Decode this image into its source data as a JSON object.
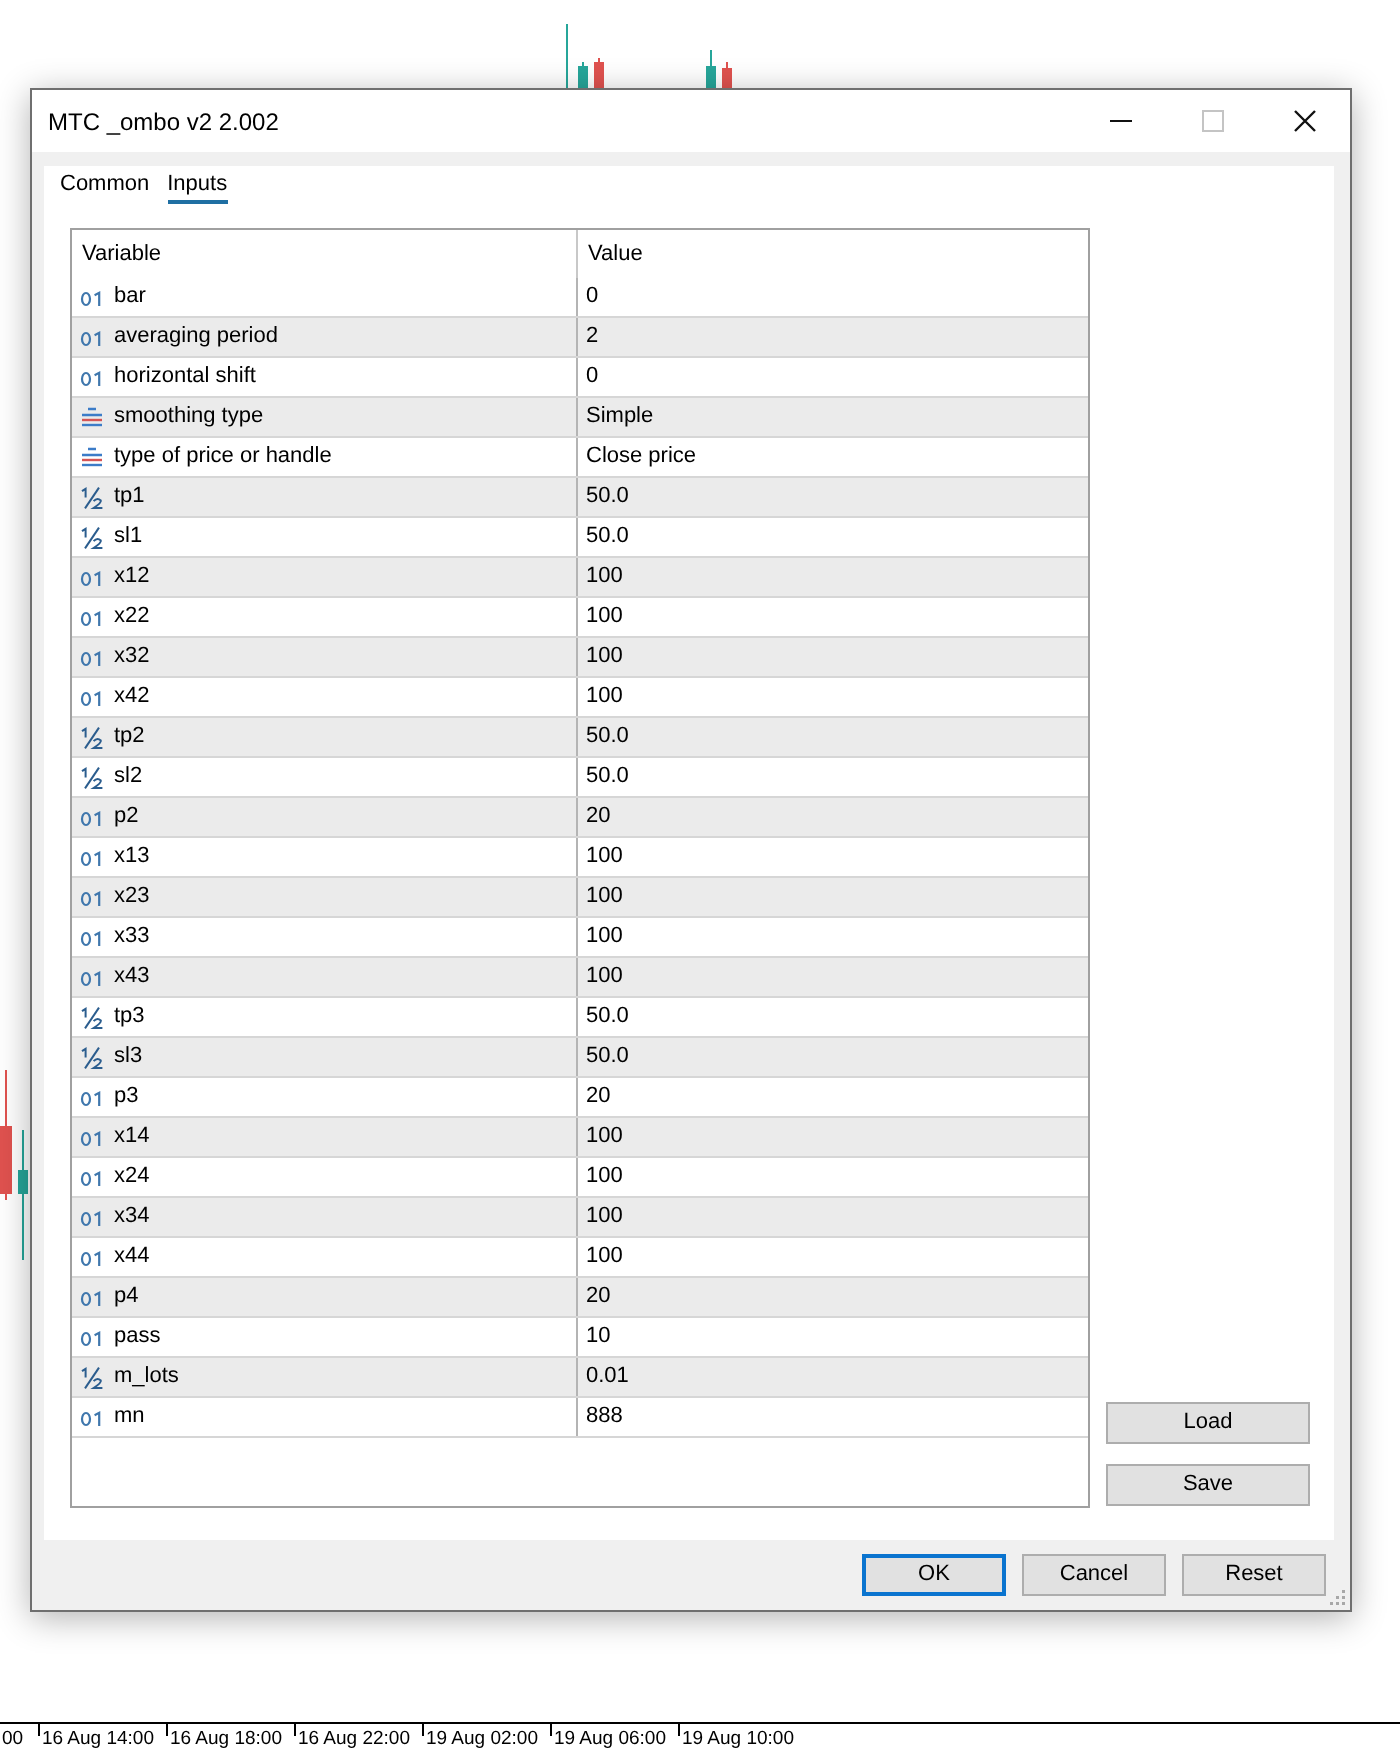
{
  "chart": {
    "time_labels": [
      "00",
      "16 Aug 14:00",
      "16 Aug 18:00",
      "16 Aug 22:00",
      "19 Aug 02:00",
      "19 Aug 06:00",
      "19 Aug 10:00"
    ]
  },
  "dialog": {
    "title": "MTC _ombo v2 2.002",
    "window_controls": [
      {
        "kind": "minimize",
        "disabled": false
      },
      {
        "kind": "maximize",
        "disabled": true
      },
      {
        "kind": "close",
        "disabled": false
      }
    ],
    "tabs": [
      {
        "label": "Common",
        "selected": false
      },
      {
        "label": "Inputs",
        "selected": true
      }
    ],
    "table": {
      "columns": [
        "Variable",
        "Value"
      ],
      "rows": [
        {
          "kind": "int",
          "variable": "bar",
          "value": "0"
        },
        {
          "kind": "int",
          "variable": "averaging period",
          "value": "2"
        },
        {
          "kind": "int",
          "variable": "horizontal shift",
          "value": "0"
        },
        {
          "kind": "enum",
          "variable": "smoothing type",
          "value": "Simple"
        },
        {
          "kind": "enum",
          "variable": "type of price or handle",
          "value": "Close price"
        },
        {
          "kind": "double",
          "variable": "tp1",
          "value": "50.0"
        },
        {
          "kind": "double",
          "variable": "sl1",
          "value": "50.0"
        },
        {
          "kind": "int",
          "variable": "x12",
          "value": "100"
        },
        {
          "kind": "int",
          "variable": "x22",
          "value": "100"
        },
        {
          "kind": "int",
          "variable": "x32",
          "value": "100"
        },
        {
          "kind": "int",
          "variable": "x42",
          "value": "100"
        },
        {
          "kind": "double",
          "variable": "tp2",
          "value": "50.0"
        },
        {
          "kind": "double",
          "variable": "sl2",
          "value": "50.0"
        },
        {
          "kind": "int",
          "variable": "p2",
          "value": "20"
        },
        {
          "kind": "int",
          "variable": "x13",
          "value": "100"
        },
        {
          "kind": "int",
          "variable": "x23",
          "value": "100"
        },
        {
          "kind": "int",
          "variable": "x33",
          "value": "100"
        },
        {
          "kind": "int",
          "variable": "x43",
          "value": "100"
        },
        {
          "kind": "double",
          "variable": "tp3",
          "value": "50.0"
        },
        {
          "kind": "double",
          "variable": "sl3",
          "value": "50.0"
        },
        {
          "kind": "int",
          "variable": "p3",
          "value": "20"
        },
        {
          "kind": "int",
          "variable": "x14",
          "value": "100"
        },
        {
          "kind": "int",
          "variable": "x24",
          "value": "100"
        },
        {
          "kind": "int",
          "variable": "x34",
          "value": "100"
        },
        {
          "kind": "int",
          "variable": "x44",
          "value": "100"
        },
        {
          "kind": "int",
          "variable": "p4",
          "value": "20"
        },
        {
          "kind": "int",
          "variable": "pass",
          "value": "10"
        },
        {
          "kind": "double",
          "variable": "m_lots",
          "value": "0.01"
        },
        {
          "kind": "int",
          "variable": "mn",
          "value": "888"
        }
      ]
    },
    "side_buttons": [
      "Load",
      "Save"
    ],
    "buttons": [
      {
        "label": "OK",
        "default": true
      },
      {
        "label": "Cancel",
        "default": false
      },
      {
        "label": "Reset",
        "default": false
      }
    ]
  }
}
